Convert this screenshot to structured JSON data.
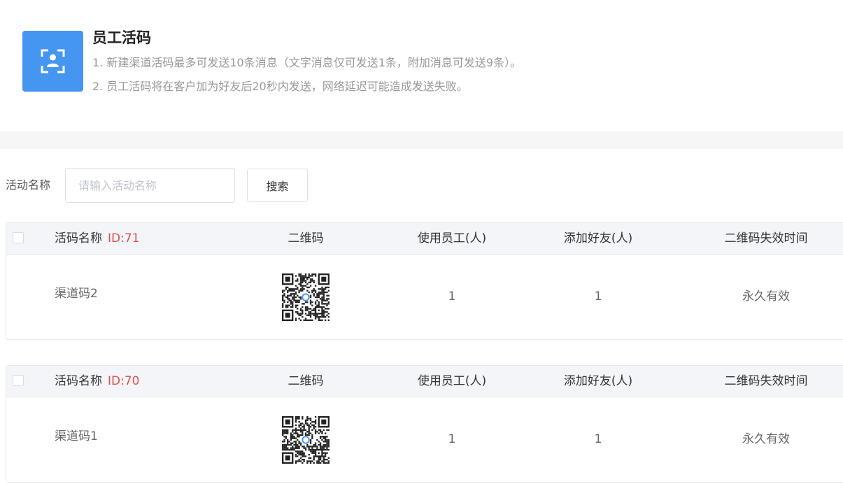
{
  "header": {
    "title": "员工活码",
    "icon": "qr-person-icon",
    "icon_color": "#4596f0",
    "notes": [
      "1. 新建渠道活码最多可发送10条消息（文字消息仅可发送1条，附加消息可发送9条）。",
      "2. 员工活码将在客户加为好友后20秒内发送，网络延迟可能造成发送失败。"
    ]
  },
  "search": {
    "label": "活动名称",
    "placeholder": "请输入活动名称",
    "value": "",
    "button_label": "搜索"
  },
  "columns": {
    "name": "活码名称",
    "qr": "二维码",
    "staff": "使用员工(人)",
    "friends": "添加好友(人)",
    "expire": "二维码失效时间"
  },
  "records": [
    {
      "id_label": "ID:71",
      "name": "渠道码2",
      "staff": "1",
      "friends": "1",
      "expire": "永久有效"
    },
    {
      "id_label": "ID:70",
      "name": "渠道码1",
      "staff": "1",
      "friends": "1",
      "expire": "永久有效"
    }
  ],
  "colors": {
    "id_color": "#e0524b",
    "header_bg": "#f3f5f8"
  }
}
